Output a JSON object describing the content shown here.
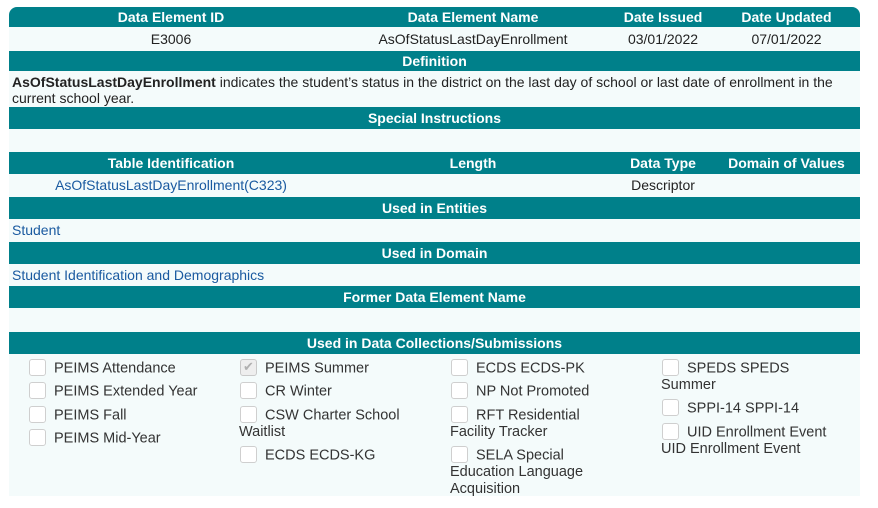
{
  "top_header": {
    "id_label": "Data Element ID",
    "name_label": "Data Element Name",
    "issued_label": "Date Issued",
    "updated_label": "Date Updated"
  },
  "element": {
    "id": "E3006",
    "name": "AsOfStatusLastDayEnrollment",
    "issued": "03/01/2022",
    "updated": "07/01/2022"
  },
  "definition": {
    "header": "Definition",
    "term": "AsOfStatusLastDayEnrollment",
    "text": " indicates the student’s status in the district on the last day of school or last date of enrollment in the current school year."
  },
  "special_instructions": {
    "header": "Special Instructions"
  },
  "table_header": {
    "table_id": "Table Identification",
    "length": "Length",
    "data_type": "Data Type",
    "domain": "Domain of Values"
  },
  "table_row": {
    "table_id": "AsOfStatusLastDayEnrollment(C323)",
    "length": "",
    "data_type": "Descriptor",
    "domain": ""
  },
  "used_in_entities": {
    "header": "Used in Entities",
    "value": "Student"
  },
  "used_in_domain": {
    "header": "Used in Domain",
    "value": "Student Identification and Demographics"
  },
  "former_name": {
    "header": "Former Data Element Name"
  },
  "collections": {
    "header": "Used in Data Collections/Submissions",
    "col1": [
      "PEIMS Attendance",
      "PEIMS Extended Year",
      "PEIMS Fall",
      "PEIMS Mid-Year"
    ],
    "col2": [
      "PEIMS Summer",
      "CR Winter",
      "CSW Charter School",
      "Waitlist",
      "ECDS ECDS-KG"
    ],
    "col3": [
      "ECDS ECDS-PK",
      "NP Not Promoted",
      "RFT Residential",
      "Facility Tracker",
      "SELA Special",
      "Education Language",
      "Acquisition"
    ],
    "col4": [
      "SPEDS SPEDS",
      "Summer",
      "SPPI-14 SPPI-14",
      "UID Enrollment Event",
      "UID Enrollment Event"
    ]
  }
}
